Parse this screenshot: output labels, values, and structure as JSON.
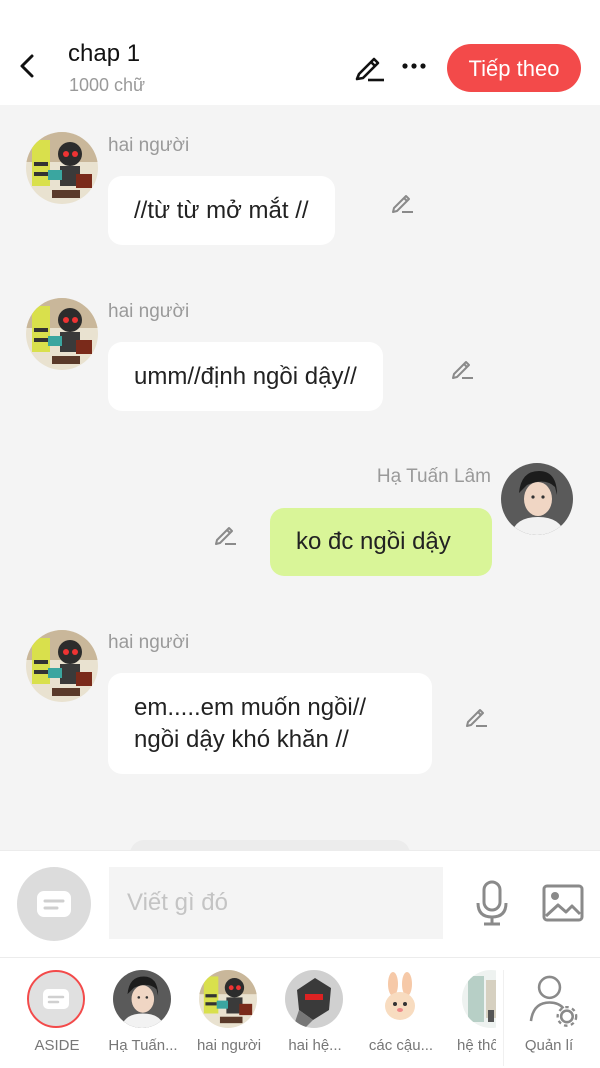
{
  "header": {
    "title": "chap 1",
    "subtitle": "1000 chữ",
    "next_label": "Tiếp theo"
  },
  "messages": [
    {
      "sender": "hai người",
      "text": "//từ từ mở mắt //",
      "side": "left"
    },
    {
      "sender": "hai người",
      "text": "umm//định ngồi dậy//",
      "side": "left"
    },
    {
      "sender": "Hạ Tuấn Lâm",
      "text": "ko đc ngồi dậy",
      "side": "right"
    },
    {
      "sender": "hai người",
      "text_line1": "em.....em muốn ngồi//",
      "text_line2": "ngồi dậy khó khăn //",
      "side": "left"
    }
  ],
  "composer": {
    "placeholder": "Viết gì đó"
  },
  "bottom_bar": {
    "items": [
      {
        "label": "ASIDE"
      },
      {
        "label": "Hạ Tuấn..."
      },
      {
        "label": "hai người"
      },
      {
        "label": "hai hệ..."
      },
      {
        "label": "các cậu..."
      },
      {
        "label": "hệ thố"
      },
      {
        "label": "Quản lí"
      }
    ]
  },
  "colors": {
    "accent": "#f34a4a",
    "my_bubble": "#d9f598",
    "their_bubble": "#ffffff",
    "background": "#f4f4f4"
  },
  "icons": [
    "back-icon",
    "pencil-icon",
    "more-icon",
    "mic-icon",
    "image-icon",
    "manage-icon",
    "aside-icon"
  ]
}
